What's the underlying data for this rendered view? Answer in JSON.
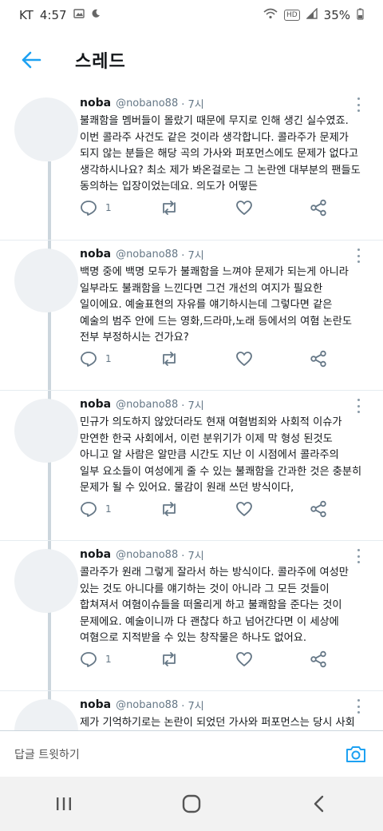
{
  "status_bar": {
    "carrier": "KT",
    "time": "4:57",
    "hd_badge": "HD",
    "battery": "35%",
    "icons": [
      "image-icon",
      "moon-icon",
      "wifi-icon",
      "hd-icon",
      "signal-icon",
      "battery-icon"
    ]
  },
  "header": {
    "title": "스레드",
    "back_icon": "back-arrow-icon",
    "accent_color": "#1da1f2"
  },
  "tweets": [
    {
      "name": "noba",
      "handle": "@nobano88",
      "time": "· 7시",
      "text": "불쾌함을 멤버들이 몰랐기 때문에 무지로 인해 생긴 실수였죠.\n이번 콜라주 사건도 같은 것이라 생각합니다. 콜라주가 문제가\n되지 않는 분들은 해당 곡의 가사와 퍼포먼스에도 문제가 없다고\n생각하시나요? 최소 제가 봐온걸로는 그 논란엔 대부분의 팬들도\n동의하는 입장이었는데요. 의도가 어떻든",
      "reply_count": "1",
      "retweet_count": "",
      "like_count": ""
    },
    {
      "name": "noba",
      "handle": "@nobano88",
      "time": "· 7시",
      "text": "백명 중에 백명 모두가 불쾌함을 느껴야 문제가 되는게 아니라\n일부라도 불쾌함을 느낀다면 그건 개선의 여지가 필요한\n일이에요. 예술표현의 자유를 얘기하시는데 그렇다면 같은\n예술의 범주 안에 드는 영화,드라마,노래 등에서의 여혐 논란도\n전부 부정하시는 건가요?",
      "reply_count": "1",
      "retweet_count": "",
      "like_count": ""
    },
    {
      "name": "noba",
      "handle": "@nobano88",
      "time": "· 7시",
      "text": "민규가 의도하지 않았더라도 현재 여혐범죄와 사회적 이슈가\n만연한 한국 사회에서, 이런 분위기가 이제 막 형성 된것도\n아니고 알 사람은 알만큼 시간도 지난 이 시점에서 콜라주의\n일부 요소들이 여성에게 줄 수 있는 불쾌함을 간과한 것은 충분히\n문제가 될 수 있어요. 물감이 원래 쓰던 방식이다,",
      "reply_count": "1",
      "retweet_count": "",
      "like_count": ""
    },
    {
      "name": "noba",
      "handle": "@nobano88",
      "time": "· 7시",
      "text": "콜라주가 원래 그렇게 잘라서 하는 방식이다. 콜라주에 여성만\n있는 것도 아니다를 얘기하는 것이 아니라 그 모든 것들이\n합쳐져서 여혐이슈들을 떠올리게 하고 불쾌함을 준다는 것이\n문제에요. 예술이니까 다 괜찮다 하고 넘어간다면 이 세상에\n여혐으로 지적받을 수 있는 창작물은 하나도 없어요.",
      "reply_count": "1",
      "retweet_count": "",
      "like_count": ""
    },
    {
      "name": "noba",
      "handle": "@nobano88",
      "time": "· 7시",
      "text": "제가 기억하기로는 논란이 되었던 가사와 퍼포먼스는 당시 사회\n분위기가 지금과 달라 당장 문제가 되지 않았던 것",
      "reply_count": "",
      "retweet_count": "",
      "like_count": ""
    }
  ],
  "reply_bar": {
    "placeholder": "답글 트윗하기",
    "camera_icon": "camera-icon"
  },
  "nav_bar": {
    "icons": [
      "recent-apps-icon",
      "home-icon",
      "back-icon"
    ]
  }
}
